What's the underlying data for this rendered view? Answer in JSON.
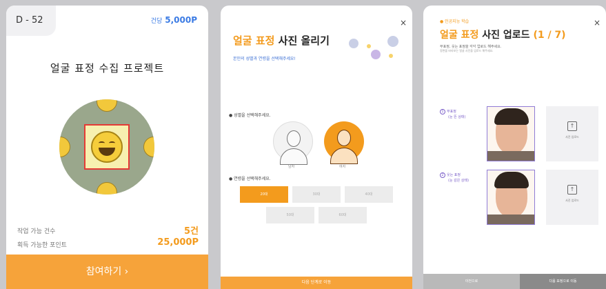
{
  "panel1": {
    "dday": "D - 52",
    "reward_prefix": "건당",
    "reward_amount": "5,000P",
    "title": "얼굴 표정 수집 프로젝트",
    "rows": [
      {
        "label": "작업 가능 건수",
        "value": "5건"
      },
      {
        "label": "획득 가능한 포인트",
        "value": "25,000P"
      }
    ],
    "cta": "참여하기 ›"
  },
  "panel2": {
    "close": "×",
    "title_accent": "얼굴 표정",
    "title_rest": "사진 올리기",
    "subtitle": "본인의 성별과 연령을 선택해주세요!",
    "gender_label": "● 성별을 선택해주세요.",
    "genders": [
      "남자",
      "여자"
    ],
    "age_label": "● 연령을 선택해주세요.",
    "ages": [
      "20대",
      "30대",
      "40대",
      "50대",
      "60대"
    ],
    "next": "다음 단계로 이동"
  },
  "panel3": {
    "close": "×",
    "tag": "● 인공지능 학습",
    "title_accent": "얼굴 표정",
    "title_rest": "사진 업로드",
    "progress": "(1 / 7)",
    "sub1": "무표정, 웃는 표정을 각각 업로드 해주세요.",
    "sub2": "정면을 바라보는 얼굴 사진을 업로드 해주세요.",
    "items": [
      {
        "num": "1",
        "label": "무표정",
        "sublabel": "(눈 뜬 상태)",
        "slot": "사진 업로드"
      },
      {
        "num": "2",
        "label": "웃는 표정",
        "sublabel": "(눈 감은 상태)",
        "slot": "사진 업로드"
      }
    ],
    "foot_left": "이전으로",
    "foot_right": "다음 표정으로 이동"
  }
}
